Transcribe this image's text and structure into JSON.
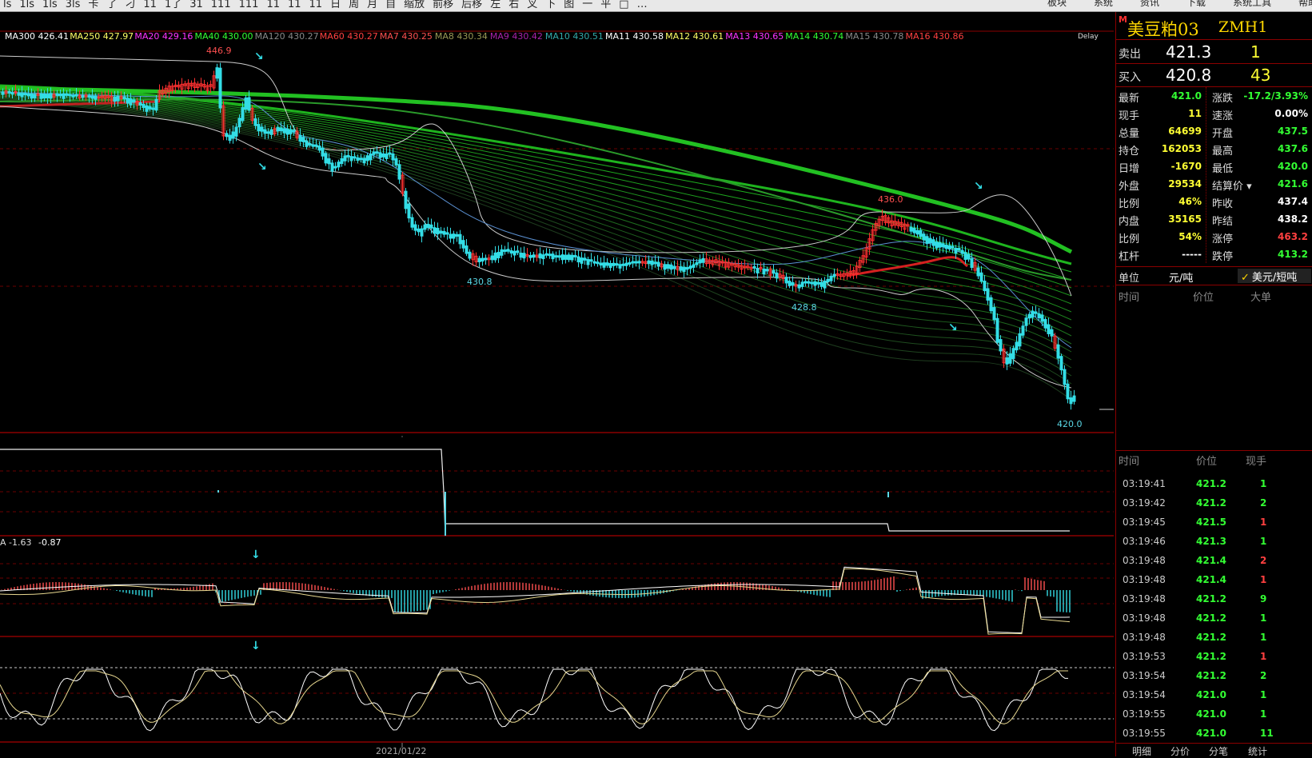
{
  "toolbar": {
    "icons": [
      "ls",
      "1ls",
      "1ls",
      "3ls",
      "卡",
      "了",
      "刁",
      "11",
      "1了",
      "31",
      "111",
      "111",
      "11",
      "11",
      "11",
      "日",
      "周",
      "月",
      "自",
      "缩放",
      "前移",
      "后移",
      "左",
      "右",
      "叉",
      "下",
      "图",
      "一",
      "平",
      "□",
      "…"
    ],
    "menus": [
      "板块",
      "系统",
      "资讯",
      "下载",
      "系统工具",
      "帮助"
    ]
  },
  "price_panel": {
    "ma_legend": [
      {
        "label": "MA300",
        "value": "426.41",
        "color": "#ffffff"
      },
      {
        "label": "MA250",
        "value": "427.97",
        "color": "#ffff66"
      },
      {
        "label": "MA20",
        "value": "429.16",
        "color": "#ff33ff"
      },
      {
        "label": "MA40",
        "value": "430.00",
        "color": "#33ff33"
      },
      {
        "label": "MA120",
        "value": "430.27",
        "color": "#888888"
      },
      {
        "label": "MA60",
        "value": "430.27",
        "color": "#ff4040"
      },
      {
        "label": "MA7",
        "value": "430.25",
        "color": "#ff5050"
      },
      {
        "label": "MA8",
        "value": "430.34",
        "color": "#999955"
      },
      {
        "label": "MA9",
        "value": "430.42",
        "color": "#aa22aa"
      },
      {
        "label": "MA10",
        "value": "430.51",
        "color": "#33aaaa"
      },
      {
        "label": "MA11",
        "value": "430.58",
        "color": "#ffffff"
      },
      {
        "label": "MA12",
        "value": "430.61",
        "color": "#ffff66"
      },
      {
        "label": "MA13",
        "value": "430.65",
        "color": "#ff33ff"
      },
      {
        "label": "MA14",
        "value": "430.74",
        "color": "#33ff33"
      },
      {
        "label": "MA15",
        "value": "430.78",
        "color": "#888888"
      },
      {
        "label": "MA16",
        "value": "430.86",
        "color": "#ff4040"
      }
    ],
    "delay": "Delay",
    "annotations": [
      "446.9",
      "430.8",
      "428.8",
      "436.0",
      "420.0"
    ]
  },
  "macd_panel": {
    "label": "A -1.63",
    "value": "-0.87"
  },
  "date_label": "2021/01/22",
  "quote": {
    "marker": "M",
    "name": "美豆粕03",
    "code": "ZMH1",
    "ask": {
      "label": "卖出",
      "price": "421.3",
      "qty": "1"
    },
    "bid": {
      "label": "买入",
      "price": "420.8",
      "qty": "43"
    },
    "stats": [
      {
        "l1": "最新",
        "v1": "421.0",
        "c1": "#33ff33",
        "l2": "涨跌",
        "v2": "-17.2/3.93%",
        "c2": "#33ff33"
      },
      {
        "l1": "现手",
        "v1": "11",
        "c1": "#ffff33",
        "l2": "速涨",
        "v2": "0.00%",
        "c2": "#ffffff"
      },
      {
        "l1": "总量",
        "v1": "64699",
        "c1": "#ffff33",
        "l2": "开盘",
        "v2": "437.5",
        "c2": "#33ff33"
      },
      {
        "l1": "持仓",
        "v1": "162053",
        "c1": "#ffff33",
        "l2": "最高",
        "v2": "437.6",
        "c2": "#33ff33"
      },
      {
        "l1": "日增",
        "v1": "-1670",
        "c1": "#ffff33",
        "l2": "最低",
        "v2": "420.0",
        "c2": "#33ff33"
      },
      {
        "l1": "外盘",
        "v1": "29534",
        "c1": "#ffff33",
        "l2": "结算价",
        "v2": "421.6",
        "c2": "#33ff33"
      },
      {
        "l1": "比例",
        "v1": "46%",
        "c1": "#ffff33",
        "l2": "昨收",
        "v2": "437.4",
        "c2": "#ffffff"
      },
      {
        "l1": "内盘",
        "v1": "35165",
        "c1": "#ffff33",
        "l2": "昨结",
        "v2": "438.2",
        "c2": "#ffffff"
      },
      {
        "l1": "比例",
        "v1": "54%",
        "c1": "#ffff33",
        "l2": "涨停",
        "v2": "463.2",
        "c2": "#ff4040"
      },
      {
        "l1": "杠杆",
        "v1": "-----",
        "c1": "#ffffff",
        "l2": "跌停",
        "v2": "413.2",
        "c2": "#33ff33"
      }
    ],
    "unit": {
      "label": "单位",
      "opt1": "元/吨",
      "opt2": "美元/短吨"
    },
    "big_head": {
      "time": "时间",
      "price": "价位",
      "big": "大单"
    },
    "trade_head": {
      "time": "时间",
      "price": "价位",
      "qty": "现手"
    },
    "trades": [
      {
        "time": "03:19:41",
        "price": "421.2",
        "qty": "1",
        "qc": "#33ff33"
      },
      {
        "time": "03:19:42",
        "price": "421.2",
        "qty": "2",
        "qc": "#33ff33"
      },
      {
        "time": "03:19:45",
        "price": "421.5",
        "qty": "1",
        "qc": "#ff4040"
      },
      {
        "time": "03:19:46",
        "price": "421.3",
        "qty": "1",
        "qc": "#33ff33"
      },
      {
        "time": "03:19:48",
        "price": "421.4",
        "qty": "2",
        "qc": "#ff4040"
      },
      {
        "time": "03:19:48",
        "price": "421.4",
        "qty": "1",
        "qc": "#ff4040"
      },
      {
        "time": "03:19:48",
        "price": "421.2",
        "qty": "9",
        "qc": "#33ff33"
      },
      {
        "time": "03:19:48",
        "price": "421.2",
        "qty": "1",
        "qc": "#33ff33"
      },
      {
        "time": "03:19:48",
        "price": "421.2",
        "qty": "1",
        "qc": "#33ff33"
      },
      {
        "time": "03:19:53",
        "price": "421.2",
        "qty": "1",
        "qc": "#ff4040"
      },
      {
        "time": "03:19:54",
        "price": "421.2",
        "qty": "2",
        "qc": "#33ff33"
      },
      {
        "time": "03:19:54",
        "price": "421.0",
        "qty": "1",
        "qc": "#33ff33"
      },
      {
        "time": "03:19:55",
        "price": "421.0",
        "qty": "1",
        "qc": "#33ff33"
      },
      {
        "time": "03:19:55",
        "price": "421.0",
        "qty": "11",
        "qc": "#33ff33"
      }
    ],
    "tabs": [
      "明细",
      "分价",
      "分笔",
      "统计"
    ]
  }
}
